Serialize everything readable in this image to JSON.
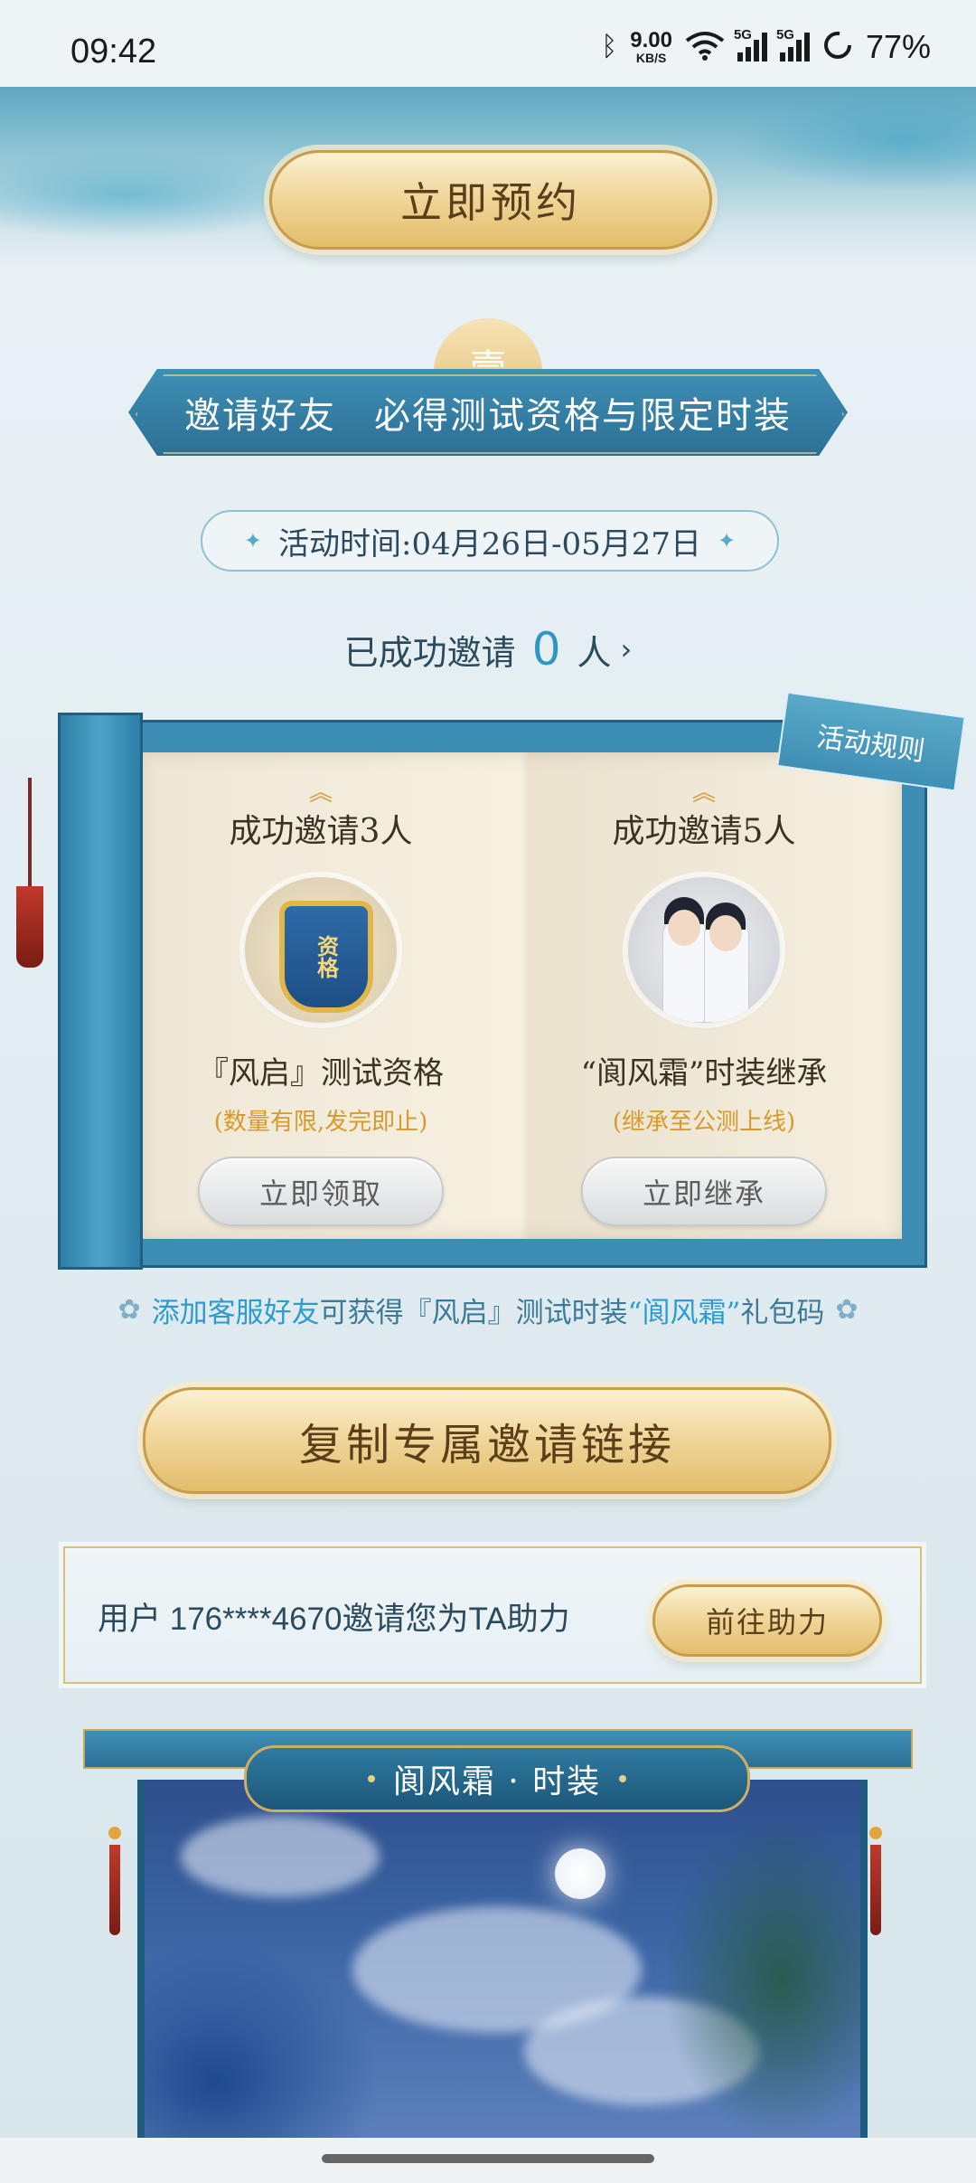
{
  "status_bar": {
    "time": "09:42",
    "net_speed_value": "9.00",
    "net_speed_unit": "KB/S",
    "signal_1_label": "5G",
    "signal_2_label": "5G",
    "battery": "77%",
    "icons": [
      "bluetooth-icon",
      "wifi-icon",
      "signal-icon",
      "battery-icon"
    ]
  },
  "header": {
    "reserve_label": "立即预约",
    "badge_char": "壹"
  },
  "invite_section": {
    "banner_text": "邀请好友　必得测试资格与限定时装",
    "event_time": "活动时间:04月26日-05月27日",
    "invited_label": "已成功邀请",
    "invited_count": "0",
    "invited_unit": "人",
    "rules_label": "活动规则"
  },
  "rewards": [
    {
      "title": "成功邀请3人",
      "icon_text": "资格",
      "name": "『风启』测试资格",
      "note": "(数量有限,发完即止)",
      "button": "立即领取"
    },
    {
      "title": "成功邀请5人",
      "name": "“阆风霜”时装继承",
      "note": "(继承至公测上线)",
      "button": "立即继承"
    }
  ],
  "customer_service_note": {
    "part1": "添加客服好友",
    "part2": "可获得『风启』测试时装",
    "part3": "“阆风霜”",
    "part4": "礼包码"
  },
  "copy_link_label": "复制专属邀请链接",
  "helper": {
    "text": "用户 176****4670邀请您为TA助力",
    "button": "前往助力"
  },
  "costume_banner": {
    "title": "阆风霜 · 时装"
  },
  "colors": {
    "accent_blue": "#2f95c3",
    "gold": "#e3bd6c",
    "note_orange": "#d69a2c"
  }
}
